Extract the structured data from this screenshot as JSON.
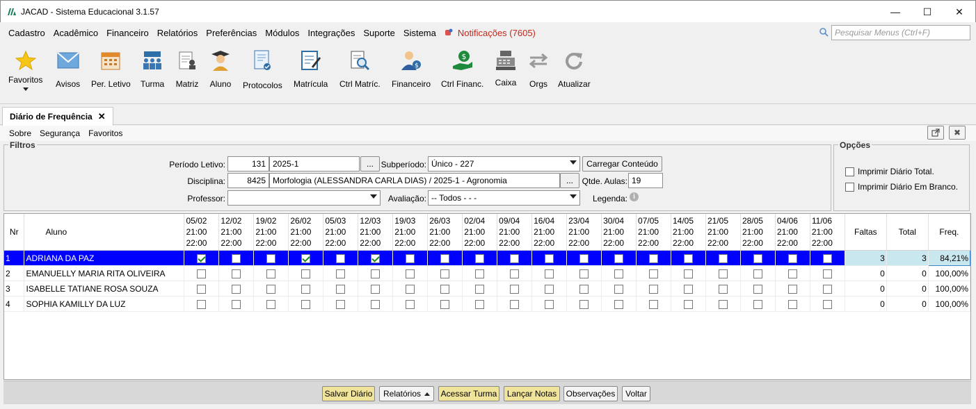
{
  "window": {
    "title": "JACAD - Sistema Educacional 3.1.57"
  },
  "menubar": {
    "items": [
      "Cadastro",
      "Acadêmico",
      "Financeiro",
      "Relatórios",
      "Preferências",
      "Módulos",
      "Integrações",
      "Suporte",
      "Sistema"
    ],
    "notifications": "Notificações (7605)",
    "search_placeholder": "Pesquisar Menus (Ctrl+F)"
  },
  "toolbar": {
    "favoritos": "Favoritos",
    "avisos": "Avisos",
    "per_letivo": "Per. Letivo",
    "turma": "Turma",
    "matriz": "Matriz",
    "aluno": "Aluno",
    "protocolos": "Protocolos",
    "matricula": "Matrícula",
    "ctrl_matric": "Ctrl Matríc.",
    "financeiro": "Financeiro",
    "ctrl_financ": "Ctrl Financ.",
    "caixa": "Caixa",
    "orgs": "Orgs",
    "atualizar": "Atualizar"
  },
  "tab": {
    "label": "Diário de Frequência"
  },
  "submenu": {
    "sobre": "Sobre",
    "seguranca": "Segurança",
    "favoritos": "Favoritos"
  },
  "filtros": {
    "legend": "Filtros",
    "periodo_label": "Período Letivo:",
    "periodo_code": "131",
    "periodo_value": "2025-1",
    "ellipsis": "...",
    "subperiodo_label": "Subperíodo:",
    "subperiodo_value": "Único - 227",
    "carregar": "Carregar Conteúdo",
    "disciplina_label": "Disciplina:",
    "disciplina_code": "8425",
    "disciplina_value": "Morfologia  (ALESSANDRA CARLA DIAS) / 2025-1 - Agronomia",
    "qtde_label": "Qtde. Aulas:",
    "qtde_value": "19",
    "professor_label": "Professor:",
    "professor_value": "",
    "avaliacao_label": "Avaliação:",
    "avaliacao_value": "-- Todos - -  -",
    "legenda_label": "Legenda:"
  },
  "opcoes": {
    "legend": "Opções",
    "opt1": "Imprimir Diário Total.",
    "opt2": "Imprimir Diário Em Branco."
  },
  "table": {
    "col_nr": "Nr",
    "col_aluno": "Aluno",
    "col_faltas": "Faltas",
    "col_total": "Total",
    "col_freq": "Freq.",
    "dates": [
      {
        "d": "05/02",
        "s": "21:00",
        "e": "22:00"
      },
      {
        "d": "12/02",
        "s": "21:00",
        "e": "22:00"
      },
      {
        "d": "19/02",
        "s": "21:00",
        "e": "22:00"
      },
      {
        "d": "26/02",
        "s": "21:00",
        "e": "22:00"
      },
      {
        "d": "05/03",
        "s": "21:00",
        "e": "22:00"
      },
      {
        "d": "12/03",
        "s": "21:00",
        "e": "22:00"
      },
      {
        "d": "19/03",
        "s": "21:00",
        "e": "22:00"
      },
      {
        "d": "26/03",
        "s": "21:00",
        "e": "22:00"
      },
      {
        "d": "02/04",
        "s": "21:00",
        "e": "22:00"
      },
      {
        "d": "09/04",
        "s": "21:00",
        "e": "22:00"
      },
      {
        "d": "16/04",
        "s": "21:00",
        "e": "22:00"
      },
      {
        "d": "23/04",
        "s": "21:00",
        "e": "22:00"
      },
      {
        "d": "30/04",
        "s": "21:00",
        "e": "22:00"
      },
      {
        "d": "07/05",
        "s": "21:00",
        "e": "22:00"
      },
      {
        "d": "14/05",
        "s": "21:00",
        "e": "22:00"
      },
      {
        "d": "21/05",
        "s": "21:00",
        "e": "22:00"
      },
      {
        "d": "28/05",
        "s": "21:00",
        "e": "22:00"
      },
      {
        "d": "04/06",
        "s": "21:00",
        "e": "22:00"
      },
      {
        "d": "11/06",
        "s": "21:00",
        "e": "22:00"
      }
    ],
    "rows": [
      {
        "nr": "1",
        "aluno": "ADRIANA DA PAZ",
        "checks": [
          1,
          0,
          0,
          1,
          0,
          1,
          0,
          0,
          0,
          0,
          0,
          0,
          0,
          0,
          0,
          0,
          0,
          0,
          0
        ],
        "faltas": "3",
        "total": "3",
        "freq": "84,21%"
      },
      {
        "nr": "2",
        "aluno": "EMANUELLY MARIA RITA OLIVEIRA",
        "checks": [
          0,
          0,
          0,
          0,
          0,
          0,
          0,
          0,
          0,
          0,
          0,
          0,
          0,
          0,
          0,
          0,
          0,
          0,
          0
        ],
        "faltas": "0",
        "total": "0",
        "freq": "100,00%"
      },
      {
        "nr": "3",
        "aluno": "ISABELLE TATIANE ROSA SOUZA",
        "checks": [
          0,
          0,
          0,
          0,
          0,
          0,
          0,
          0,
          0,
          0,
          0,
          0,
          0,
          0,
          0,
          0,
          0,
          0,
          0
        ],
        "faltas": "0",
        "total": "0",
        "freq": "100,00%"
      },
      {
        "nr": "4",
        "aluno": "SOPHIA KAMILLY DA LUZ",
        "checks": [
          0,
          0,
          0,
          0,
          0,
          0,
          0,
          0,
          0,
          0,
          0,
          0,
          0,
          0,
          0,
          0,
          0,
          0,
          0
        ],
        "faltas": "0",
        "total": "0",
        "freq": "100,00%"
      }
    ]
  },
  "bottom": {
    "salvar": "Salvar Diário",
    "relatorios": "Relatórios",
    "acessar": "Acessar Turma",
    "lancar": "Lançar Notas",
    "observacoes": "Observações",
    "voltar": "Voltar"
  },
  "colors": {
    "selection": "#0000ff",
    "notif": "#c4261a",
    "yellow_btn": "#f0e39a",
    "check": "#1a8a1a"
  }
}
